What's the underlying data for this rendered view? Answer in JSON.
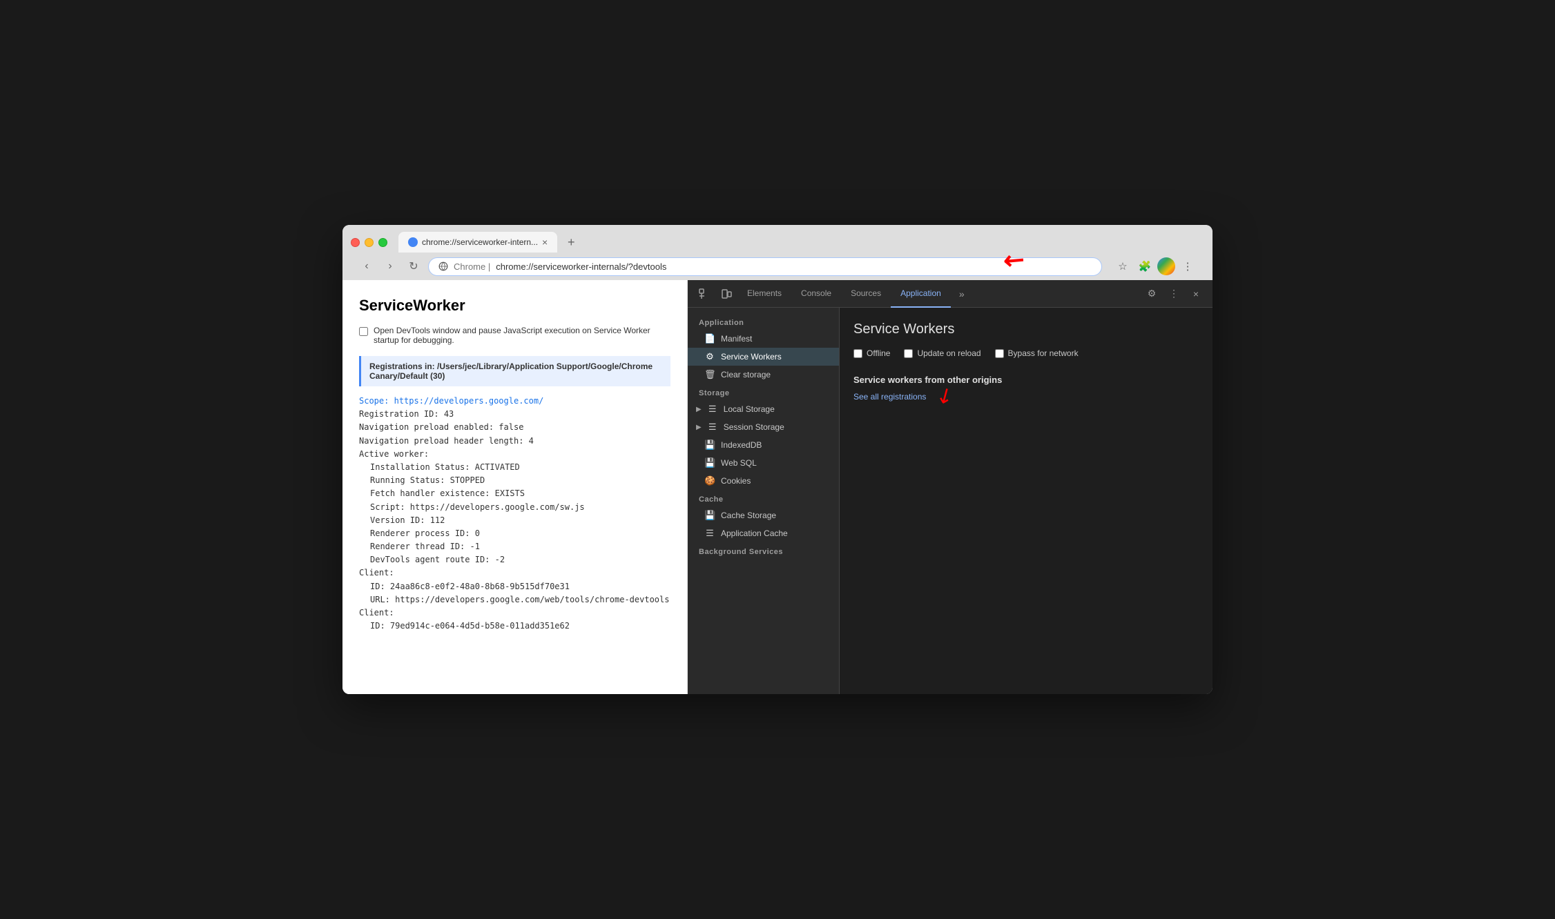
{
  "browser": {
    "tab_title": "chrome://serviceworker-intern...",
    "tab_close": "×",
    "tab_new": "+",
    "url_domain": "Chrome  |",
    "url_path": "chrome://serviceworker-internals/?devtools",
    "nav_back": "‹",
    "nav_forward": "›",
    "nav_reload": "↻"
  },
  "toolbar_icons": {
    "star": "☆",
    "extension": "🧩",
    "menu": "⋮"
  },
  "page": {
    "title": "ServiceWorker",
    "checkbox_label": "Open DevTools window and pause JavaScript execution on Service Worker startup for debugging.",
    "registration_header": "Registrations in: /Users/jec/Library/Application Support/Google/Chrome Canary/Default (30)",
    "scope_label": "Scope:",
    "scope_url": "https://developers.google.com/",
    "reg_id": "Registration ID: 43",
    "nav_preload": "Navigation preload enabled: false",
    "nav_preload_header": "Navigation preload header length: 4",
    "active_worker": "Active worker:",
    "install_status": "Installation Status: ACTIVATED",
    "running_status": "Running Status: STOPPED",
    "fetch_handler": "Fetch handler existence: EXISTS",
    "script": "Script: https://developers.google.com/sw.js",
    "version_id": "Version ID: 112",
    "renderer_process": "Renderer process ID: 0",
    "renderer_thread": "Renderer thread ID: -1",
    "devtools_route": "DevTools agent route ID: -2",
    "client_label": "Client:",
    "client_id1": "ID: 24aa86c8-e0f2-48a0-8b68-9b515df70e31",
    "client_url1": "URL: https://developers.google.com/web/tools/chrome-devtools",
    "client_label2": "Client:",
    "client_id2": "ID: 79ed914c-e064-4d5d-b58e-011add351e62"
  },
  "devtools": {
    "tabs": [
      {
        "label": "Elements",
        "active": false
      },
      {
        "label": "Console",
        "active": false
      },
      {
        "label": "Sources",
        "active": false
      },
      {
        "label": "Application",
        "active": true
      }
    ],
    "more_tabs": "»",
    "settings_icon": "⚙",
    "more_icon": "⋮",
    "close_icon": "×",
    "sidebar": {
      "application_label": "Application",
      "items_application": [
        {
          "label": "Manifest",
          "icon": "📄"
        },
        {
          "label": "Service Workers",
          "icon": "⚙",
          "active": true
        },
        {
          "label": "Clear storage",
          "icon": "🗑"
        }
      ],
      "storage_label": "Storage",
      "items_storage": [
        {
          "label": "Local Storage",
          "icon": "☰",
          "arrow": "▶"
        },
        {
          "label": "Session Storage",
          "icon": "☰",
          "arrow": "▶"
        },
        {
          "label": "IndexedDB",
          "icon": "💾"
        },
        {
          "label": "Web SQL",
          "icon": "💾"
        },
        {
          "label": "Cookies",
          "icon": "🍪"
        }
      ],
      "cache_label": "Cache",
      "items_cache": [
        {
          "label": "Cache Storage",
          "icon": "💾"
        },
        {
          "label": "Application Cache",
          "icon": "☰"
        }
      ],
      "background_label": "Background Services"
    },
    "main": {
      "title": "Service Workers",
      "options": [
        {
          "label": "Offline"
        },
        {
          "label": "Update on reload"
        },
        {
          "label": "Bypass for network"
        }
      ],
      "other_origins_title": "Service workers from other origins",
      "see_all_link": "See all registrations"
    }
  }
}
